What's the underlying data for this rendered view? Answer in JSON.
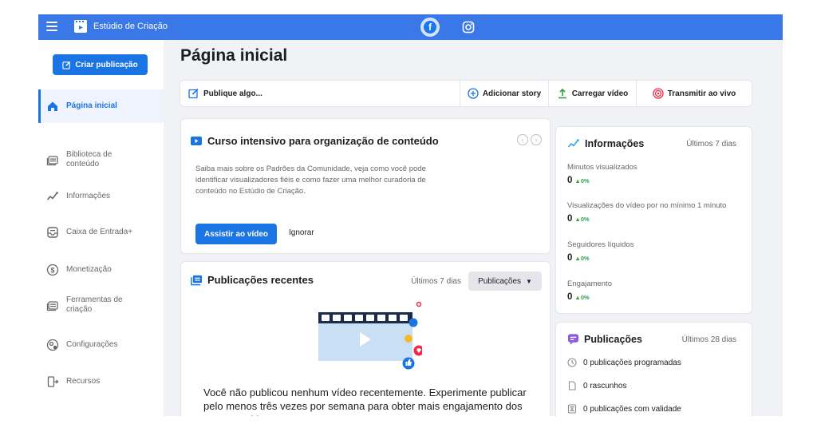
{
  "topbar": {
    "title": "Estúdio de Criação",
    "tabs": [
      {
        "name": "facebook",
        "glyph": "f"
      },
      {
        "name": "instagram"
      }
    ]
  },
  "sidebar": {
    "create_label": "Criar publicação",
    "items": [
      {
        "label": "Página inicial",
        "icon": "home-icon",
        "active": true
      },
      {
        "label": "Biblioteca de conteúdo",
        "icon": "library-icon"
      },
      {
        "label": "Informações",
        "icon": "insights-icon"
      },
      {
        "label": "Caixa de Entrada+",
        "icon": "inbox-icon"
      },
      {
        "label": "Monetização",
        "icon": "dollar-icon"
      },
      {
        "label": "Ferramentas de criação",
        "icon": "creator-tools-icon"
      },
      {
        "label": "Configurações",
        "icon": "settings-icon"
      },
      {
        "label": "Recursos",
        "icon": "resources-icon"
      }
    ]
  },
  "main": {
    "title": "Página inicial",
    "actions": {
      "post": "Publique algo...",
      "story": "Adicionar story",
      "upload": "Carregar vídeo",
      "live": "Transmitir ao vivo"
    },
    "course": {
      "title": "Curso intensivo para organização de conteúdo",
      "description": "Saiba mais sobre os Padrões da Comunidade, veja como você pode identificar visualizadores fiéis e como fazer uma melhor curadoria de conteúdo no Estúdio de Criação.",
      "watch_label": "Assistir ao vídeo",
      "ignore_label": "Ignorar",
      "prev_glyph": "‹",
      "next_glyph": "›"
    },
    "recent": {
      "title": "Publicações recentes",
      "range": "Últimos 7 dias",
      "select": "Publicações",
      "select_caret": "▼",
      "message": "Você não publicou nenhum vídeo recentemente. Experimente publicar pelo menos três vezes por semana para obter mais engajamento dos seus seguidores."
    }
  },
  "insights": {
    "title": "Informações",
    "range": "Últimos 7 dias",
    "metrics": [
      {
        "label": "Minutos visualizados",
        "value": "0",
        "change": "▲0%"
      },
      {
        "label": "Visualizações do vídeo por no mínimo 1 minuto",
        "value": "0",
        "change": "▲0%"
      },
      {
        "label": "Seguidores líquidos",
        "value": "0",
        "change": "▲0%"
      },
      {
        "label": "Engajamento",
        "value": "0",
        "change": "▲0%"
      }
    ]
  },
  "publications": {
    "title": "Publicações",
    "range": "Últimos 28 dias",
    "rows": [
      {
        "label": "0 publicações programadas",
        "icon": "clock-icon"
      },
      {
        "label": "0 rascunhos",
        "icon": "draft-icon"
      },
      {
        "label": "0 publicações com validade",
        "icon": "expiring-icon"
      }
    ]
  },
  "colors": {
    "topbar": "#3b78e7",
    "primary": "#1b74e4",
    "background": "#f0f2f5",
    "positive": "#31a24c"
  }
}
